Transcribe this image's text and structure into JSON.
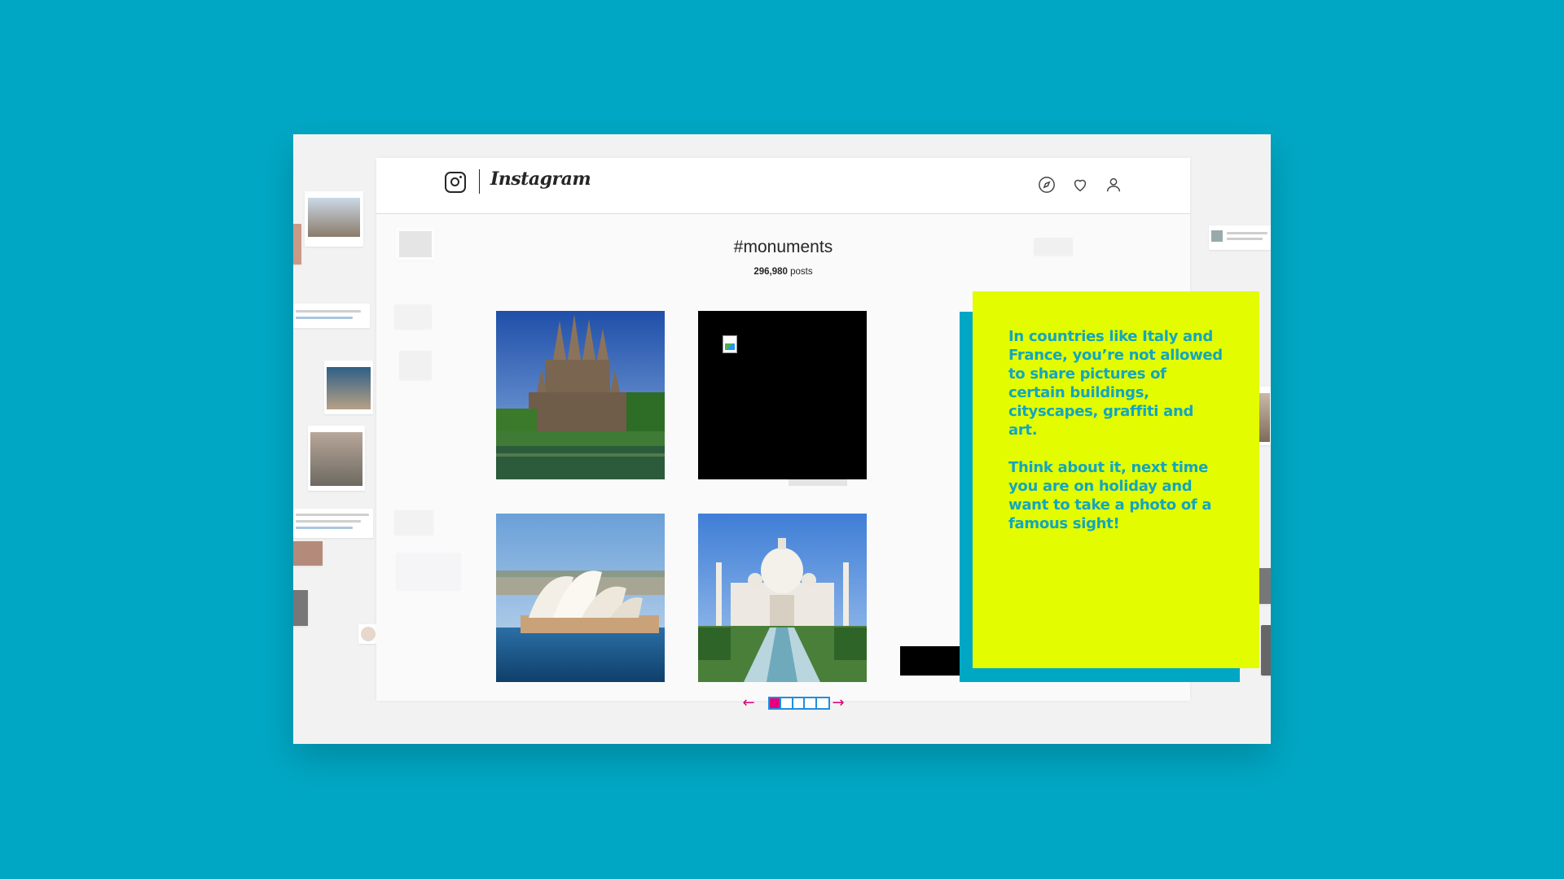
{
  "app": {
    "wordmark": "Instagram"
  },
  "nav": {
    "icons": [
      "compass-icon",
      "heart-icon",
      "user-icon"
    ]
  },
  "tag_page": {
    "hashtag": "#monuments",
    "post_count": "296,980",
    "post_label": "posts"
  },
  "grid": {
    "tiles": [
      {
        "subject": "sagrada-familia-photo"
      },
      {
        "subject": "broken-image"
      },
      {
        "subject": "sydney-opera-house-photo"
      },
      {
        "subject": "taj-mahal-photo"
      }
    ]
  },
  "pager": {
    "prev": "←",
    "next": "→",
    "pages": 5,
    "active_page": 1
  },
  "callout": {
    "paragraph_1": "In countries like Italy and France, you’re not allowed to share pictures of certain buildings, cityscapes, graffiti and art.",
    "paragraph_2": "Think about it, next time you are on holiday and want to take a photo of a famous sight!"
  },
  "colors": {
    "background": "#00a7c4",
    "callout_bg": "#e3fc00",
    "callout_text": "#13a6bf",
    "pager_active": "#e6007e",
    "pager_border": "#1f8fe0"
  }
}
